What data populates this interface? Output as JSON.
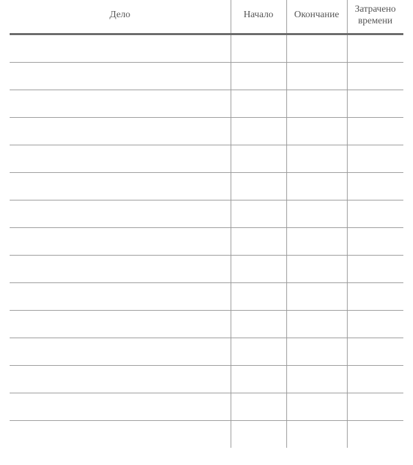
{
  "headers": {
    "task": "Дело",
    "start": "Начало",
    "end": "Окончание",
    "spent": "Затрачено\nвремени"
  },
  "rows": [
    {
      "task": "",
      "start": "",
      "end": "",
      "spent": ""
    },
    {
      "task": "",
      "start": "",
      "end": "",
      "spent": ""
    },
    {
      "task": "",
      "start": "",
      "end": "",
      "spent": ""
    },
    {
      "task": "",
      "start": "",
      "end": "",
      "spent": ""
    },
    {
      "task": "",
      "start": "",
      "end": "",
      "spent": ""
    },
    {
      "task": "",
      "start": "",
      "end": "",
      "spent": ""
    },
    {
      "task": "",
      "start": "",
      "end": "",
      "spent": ""
    },
    {
      "task": "",
      "start": "",
      "end": "",
      "spent": ""
    },
    {
      "task": "",
      "start": "",
      "end": "",
      "spent": ""
    },
    {
      "task": "",
      "start": "",
      "end": "",
      "spent": ""
    },
    {
      "task": "",
      "start": "",
      "end": "",
      "spent": ""
    },
    {
      "task": "",
      "start": "",
      "end": "",
      "spent": ""
    },
    {
      "task": "",
      "start": "",
      "end": "",
      "spent": ""
    },
    {
      "task": "",
      "start": "",
      "end": "",
      "spent": ""
    },
    {
      "task": "",
      "start": "",
      "end": "",
      "spent": ""
    }
  ]
}
